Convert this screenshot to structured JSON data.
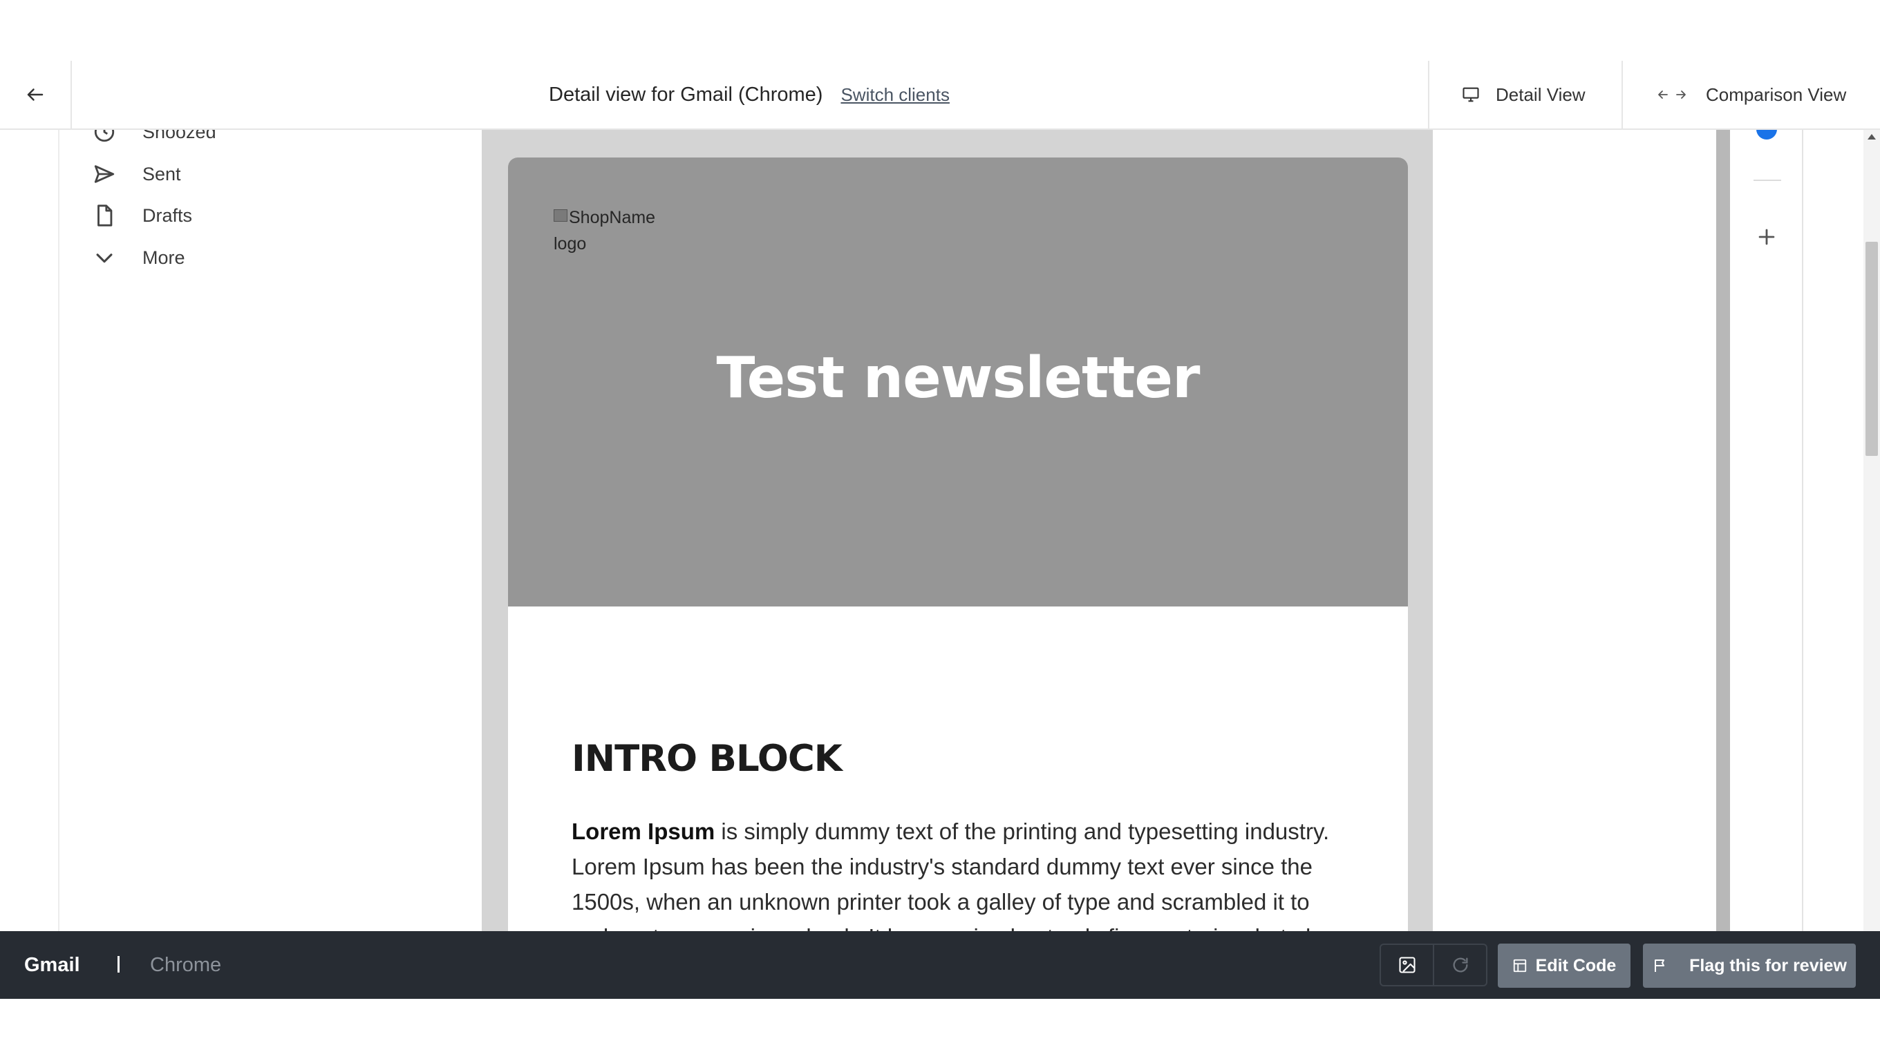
{
  "header": {
    "title": "Detail view for Gmail (Chrome)",
    "switch_clients_label": "Switch clients",
    "detail_view_label": "Detail View",
    "comparison_view_label": "Comparison View"
  },
  "sidebar": {
    "items": [
      {
        "label": "Snoozed",
        "icon": "clock-icon"
      },
      {
        "label": "Sent",
        "icon": "send-icon"
      },
      {
        "label": "Drafts",
        "icon": "file-icon"
      },
      {
        "label": "More",
        "icon": "chevron-down-icon"
      }
    ]
  },
  "email": {
    "logo_alt": "ShopName logo",
    "hero_title": "Test newsletter",
    "intro_title": "INTRO BLOCK",
    "intro_bold": "Lorem Ipsum",
    "intro_text": " is simply dummy text of the printing and typesetting industry. Lorem Ipsum has been the industry's standard dummy text ever since the 1500s, when an unknown printer took a galley of type and scrambled it to make a type specimen book. It has survived not only five centuries, but also"
  },
  "bottom": {
    "client": "Gmail",
    "separator": "|",
    "browser": "Chrome",
    "edit_code_label": "Edit Code",
    "flag_label": "Flag this for review"
  },
  "colors": {
    "toolbar_bg": "#272c33",
    "button_bg": "#6b747f",
    "hero_bg": "#969696",
    "preview_bg": "#d4d4d4",
    "accent": "#1a73e8"
  }
}
